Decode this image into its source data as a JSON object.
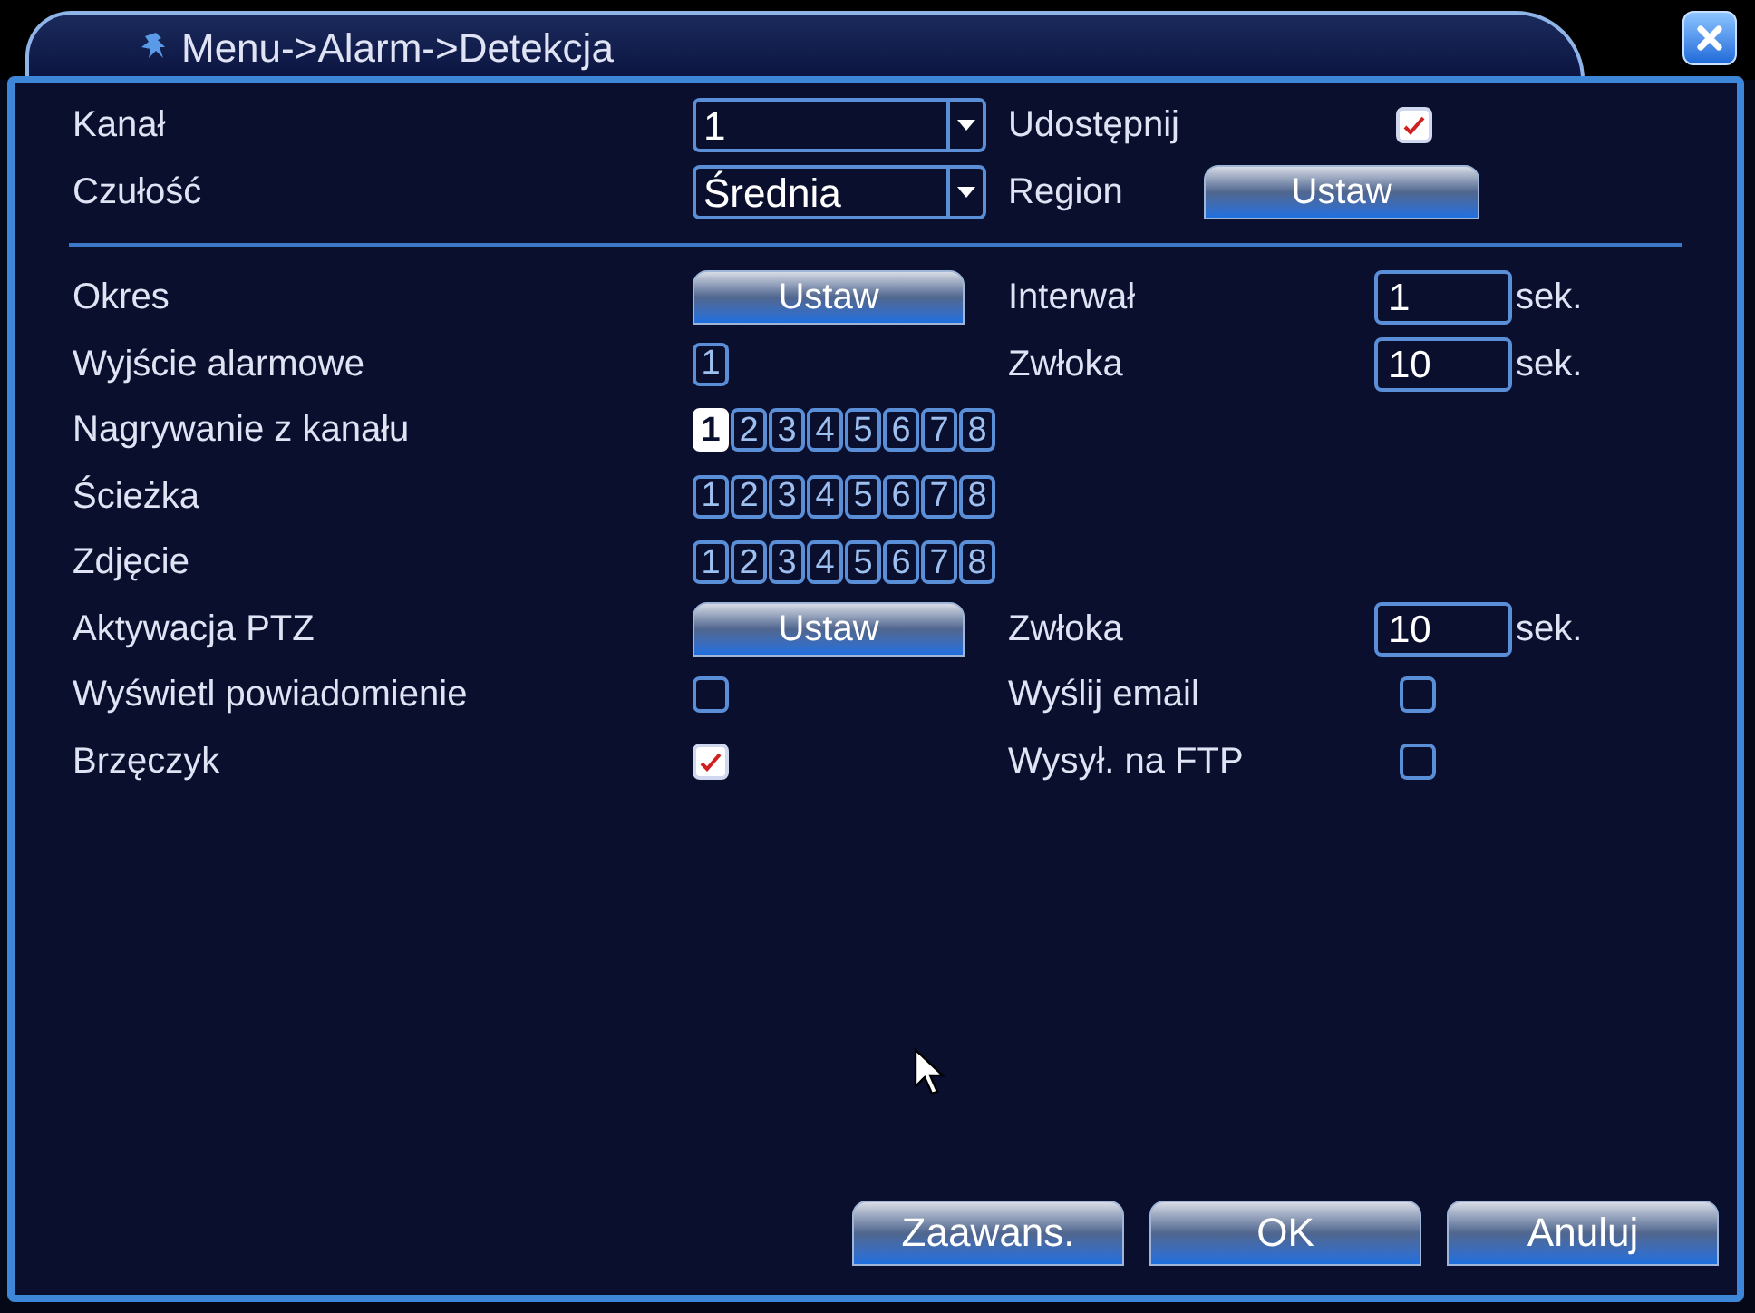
{
  "window": {
    "title": "Menu->Alarm->Detekcja"
  },
  "top_rows": [
    {
      "label": "Kanał",
      "select": "1",
      "right": {
        "kind": "checkbox",
        "label": "Udostępnij",
        "checked": true
      }
    },
    {
      "label": "Czułość",
      "select": "Średnia",
      "right": {
        "kind": "button",
        "label": "Region",
        "button": "Ustaw"
      }
    }
  ],
  "rows": [
    {
      "label": "Okres",
      "control": {
        "kind": "button",
        "text": "Ustaw"
      },
      "right": {
        "kind": "field",
        "label": "Interwał",
        "value": "1",
        "unit": "sek."
      }
    },
    {
      "label": "Wyjście alarmowe",
      "control": {
        "kind": "channels",
        "channels": [
          {
            "text": "1",
            "selected": false
          }
        ]
      },
      "right": {
        "kind": "field",
        "label": "Zwłoka",
        "value": "10",
        "unit": "sek."
      }
    },
    {
      "label": "Nagrywanie z kanału",
      "control": {
        "kind": "channels",
        "channels": [
          {
            "text": "1",
            "selected": true
          },
          {
            "text": "2",
            "selected": false
          },
          {
            "text": "3",
            "selected": false
          },
          {
            "text": "4",
            "selected": false
          },
          {
            "text": "5",
            "selected": false
          },
          {
            "text": "6",
            "selected": false
          },
          {
            "text": "7",
            "selected": false
          },
          {
            "text": "8",
            "selected": false
          }
        ]
      }
    },
    {
      "label": "Ścieżka",
      "control": {
        "kind": "channels",
        "channels": [
          {
            "text": "1",
            "selected": false
          },
          {
            "text": "2",
            "selected": false
          },
          {
            "text": "3",
            "selected": false
          },
          {
            "text": "4",
            "selected": false
          },
          {
            "text": "5",
            "selected": false
          },
          {
            "text": "6",
            "selected": false
          },
          {
            "text": "7",
            "selected": false
          },
          {
            "text": "8",
            "selected": false
          }
        ]
      }
    },
    {
      "label": "Zdjęcie",
      "control": {
        "kind": "channels",
        "channels": [
          {
            "text": "1",
            "selected": false
          },
          {
            "text": "2",
            "selected": false
          },
          {
            "text": "3",
            "selected": false
          },
          {
            "text": "4",
            "selected": false
          },
          {
            "text": "5",
            "selected": false
          },
          {
            "text": "6",
            "selected": false
          },
          {
            "text": "7",
            "selected": false
          },
          {
            "text": "8",
            "selected": false
          }
        ]
      }
    },
    {
      "label": "Aktywacja PTZ",
      "control": {
        "kind": "button",
        "text": "Ustaw"
      },
      "right": {
        "kind": "field",
        "label": "Zwłoka",
        "value": "10",
        "unit": "sek."
      }
    },
    {
      "label": "Wyświetl powiadomienie",
      "control": {
        "kind": "checkbox",
        "checked": false
      },
      "right": {
        "kind": "checkbox",
        "label": "Wyślij email",
        "checked": false
      }
    },
    {
      "label": "Brzęczyk",
      "control": {
        "kind": "checkbox",
        "checked": true
      },
      "right": {
        "kind": "checkbox",
        "label": "Wysył. na FTP",
        "checked": false
      }
    }
  ],
  "buttons": [
    "Zaawans.",
    "OK",
    "Anuluj"
  ]
}
